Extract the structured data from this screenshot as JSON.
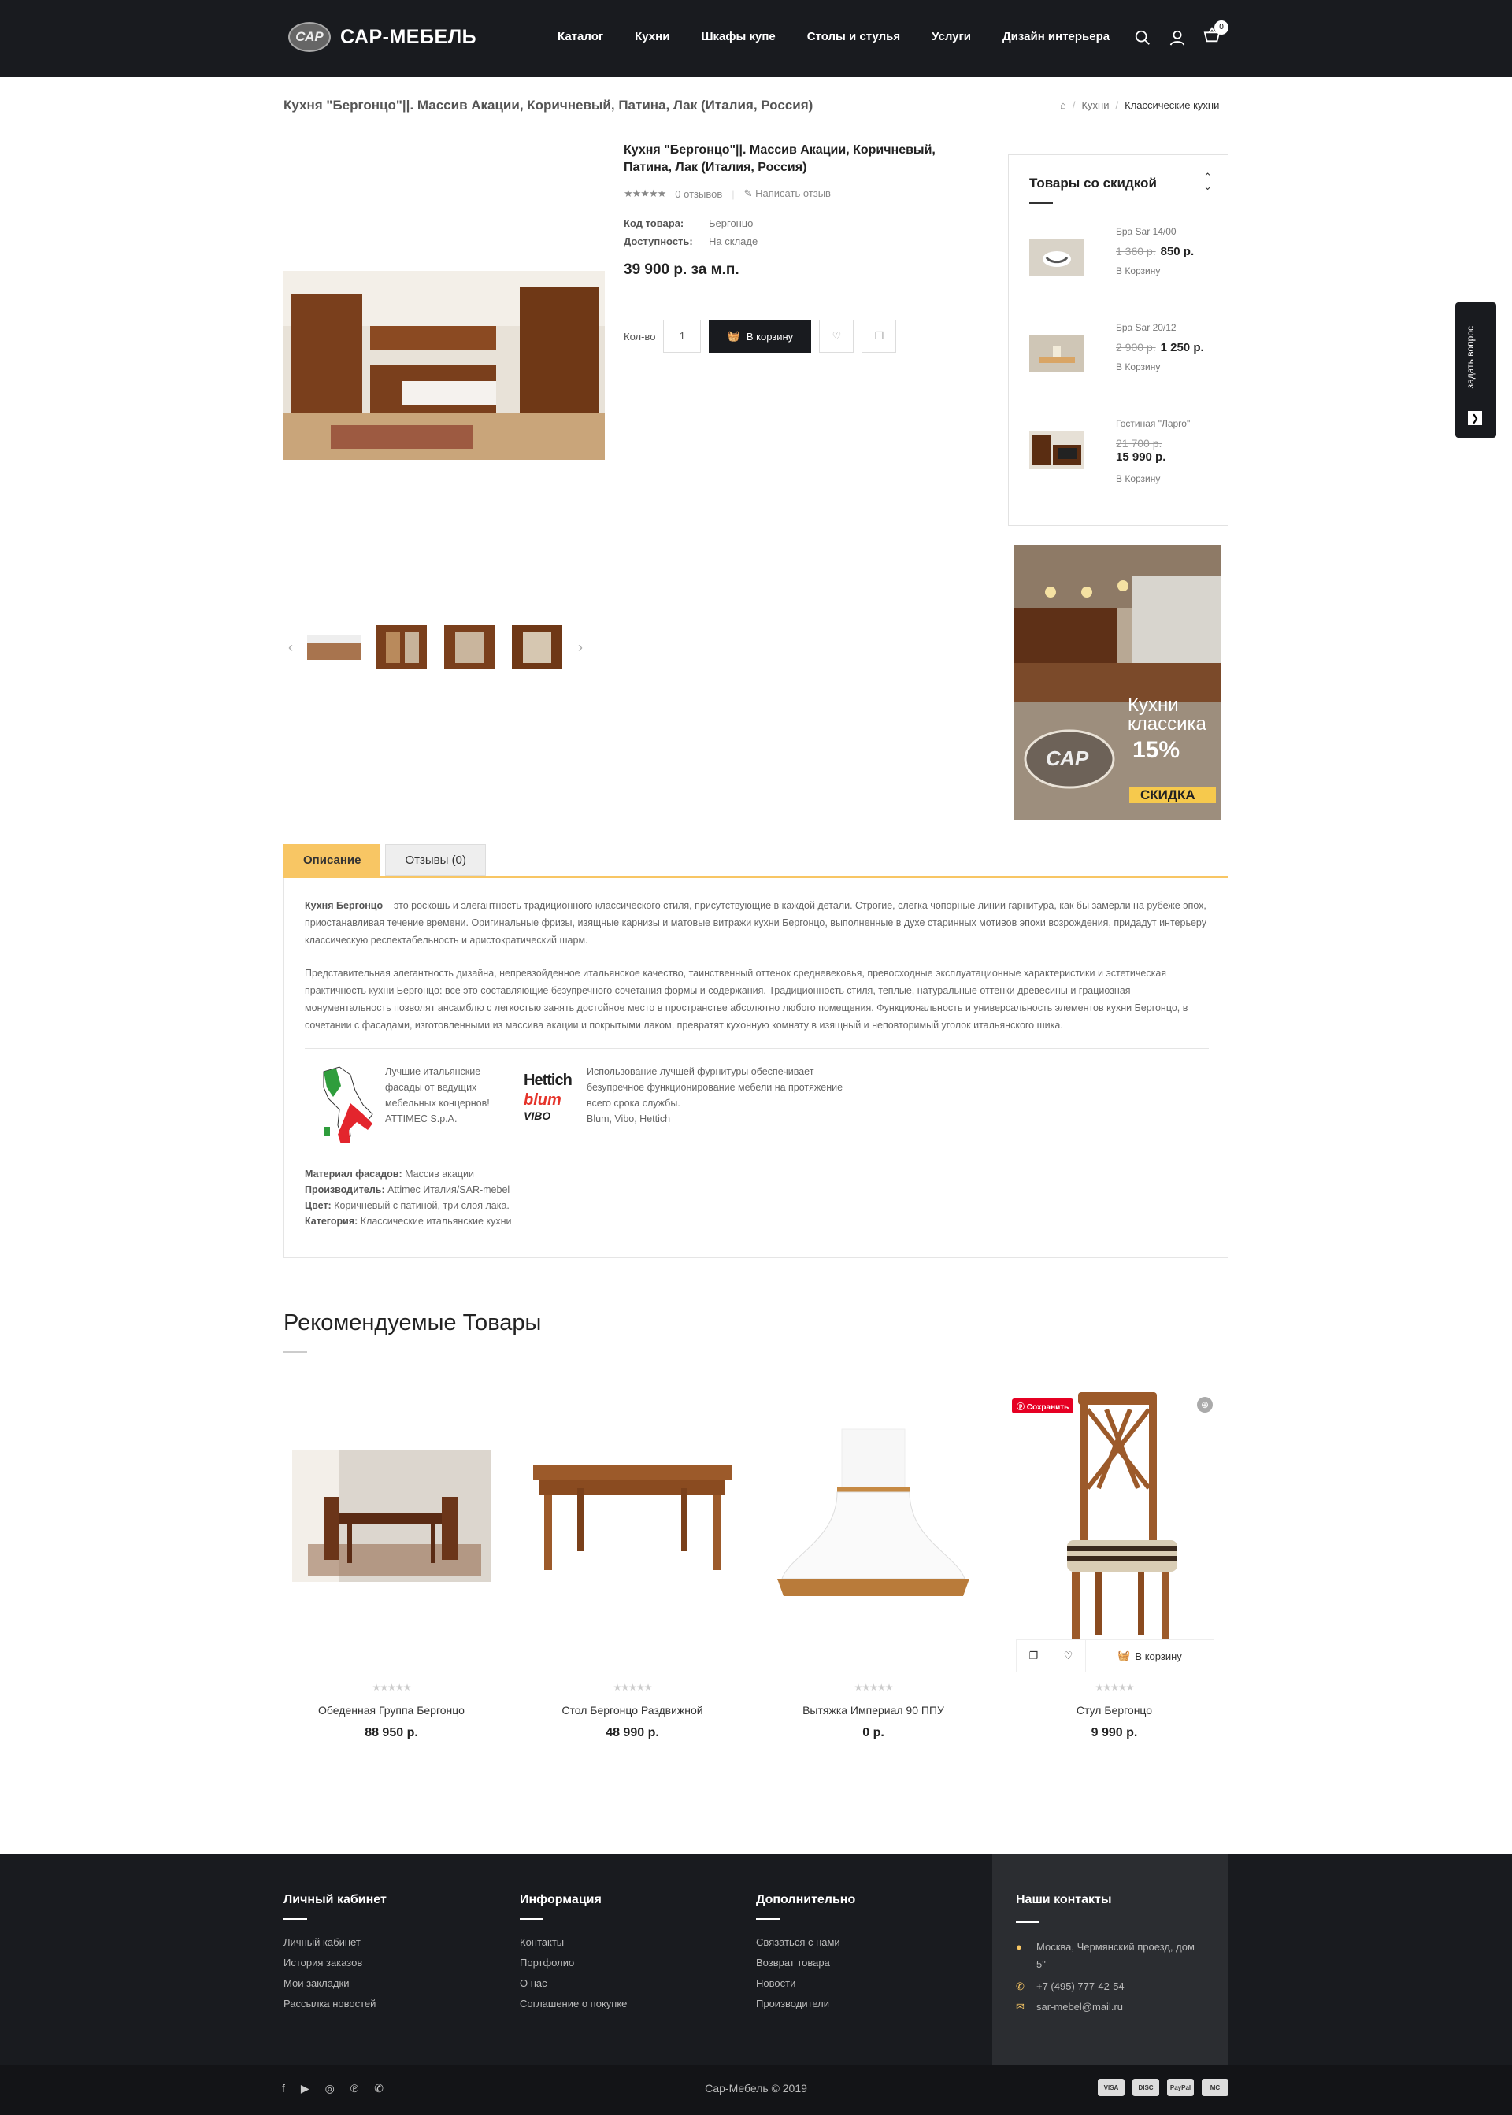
{
  "header": {
    "logo_badge": "САР",
    "logo_text": "САР-МЕБЕЛЬ",
    "nav": [
      "Каталог",
      "Кухни",
      "Шкафы купе",
      "Столы и стулья",
      "Услуги",
      "Дизайн интерьера"
    ],
    "cart_count": "0"
  },
  "page": {
    "title": "Кухня \"Бергонцо\"||. Массив Акации, Коричневый, Патина, Лак (Италия, Россия)",
    "breadcrumb": [
      "Кухни",
      "Классические кухни"
    ]
  },
  "product": {
    "title": "Кухня \"Бергонцо\"||. Массив Акации, Коричневый, Патина, Лак (Италия, Россия)",
    "reviews": "0 отзывов",
    "write_review": "Написать отзыв",
    "code_label": "Код товара:",
    "code_value": "Бергонцо",
    "avail_label": "Доступность:",
    "avail_value": "На складе",
    "price": "39 900 р. за м.п.",
    "qty_label": "Кол-во",
    "qty": "1",
    "cart_btn": "В корзину"
  },
  "sidebar": {
    "title": "Товары со скидкой",
    "items": [
      {
        "name": "Бра Sar 14/00",
        "old": "1 360 р.",
        "price": "850 р.",
        "action": "В Корзину"
      },
      {
        "name": "Бра Sar 20/12",
        "old": "2 900 р.",
        "price": "1 250 р.",
        "action": "В Корзину"
      },
      {
        "name": "Гостиная \"Ларго\"",
        "old": "21 700 р.",
        "price": "15 990 р.",
        "action": "В Корзину"
      }
    ]
  },
  "banner": {
    "l1": "Кухни",
    "l2": "классика",
    "l3": "15%",
    "l4": "СКИДКА",
    "badge": "САР"
  },
  "ask": "задать вопрос",
  "tabs": {
    "desc": "Описание",
    "reviews": "Отзывы (0)"
  },
  "description": {
    "p1_bold": "Кухня Бергонцо",
    "p1": " – это роскошь и элегантность традиционного классического стиля, присутствующие в каждой детали. Строгие, слегка чопорные линии гарнитура, как бы замерли на рубеже эпох, приостанавливая течение времени. Оригинальные фризы, изящные карнизы и матовые витражи кухни Бергонцо, выполненные в духе старинных мотивов эпохи возрождения, придадут интерьеру классическую респектабельность и аристократический шарм.",
    "p2": "Представительная элегантность дизайна, непревзойденное итальянское качество, таинственный оттенок средневековья, превосходные эксплуатационные характеристики и эстетическая практичность кухни Бергонцо: все это составляющие безупречного сочетания формы и содержания. Традиционность стиля, теплые, натуральные оттенки древесины и грациозная монументальность позволят ансамблю с легкостью занять достойное место в пространстве абсолютно любого помещения. Функциональность и универсальность элементов кухни Бергонцо, в сочетании с фасадами, изготовленными из массива акации и покрытыми лаком, превратят кухонную комнату в изящный и неповторимый уголок итальянского шика.",
    "italy_text": [
      "Лучшие итальянские",
      "фасады от ведущих",
      "мебельных концернов!",
      "ATTIMEC S.p.A."
    ],
    "hw_text": [
      "Использование лучшей фурнитуры обеспечивает",
      "безупречное функционирование мебели на протяжение",
      "всего срока службы.",
      "Blum, Vibo, Hettich"
    ],
    "hw_logos": [
      "Hettich",
      "blum",
      "VIBO"
    ],
    "specs": [
      {
        "label": "Материал фасадов:",
        "value": " Массив акации"
      },
      {
        "label": "Производитель:",
        "value": " Attimec Италия/SAR-mebel"
      },
      {
        "label": "Цвет:",
        "value": " Коричневый с патиной, три слоя лака."
      },
      {
        "label": "Категория:",
        "value": " Классические итальянские кухни"
      }
    ]
  },
  "recommended": {
    "title": "Рекомендуемые Товары",
    "pin": "Сохранить",
    "cart_btn": "В корзину",
    "items": [
      {
        "name": "Обеденная Группа Бергонцо",
        "price": "88 950 р."
      },
      {
        "name": "Стол Бергонцо Раздвижной",
        "price": "48 990 р."
      },
      {
        "name": "Вытяжка Империал 90 ППУ",
        "price": "0 р."
      },
      {
        "name": "Стул Бергонцо",
        "price": "9 990 р."
      }
    ]
  },
  "footer": {
    "col1": {
      "title": "Личный кабинет",
      "links": [
        "Личный кабинет",
        "История заказов",
        "Мои закладки",
        "Рассылка новостей"
      ]
    },
    "col2": {
      "title": "Информация",
      "links": [
        "Контакты",
        "Портфолио",
        "О нас",
        "Соглашение о покупке"
      ]
    },
    "col3": {
      "title": "Дополнительно",
      "links": [
        "Связаться с нами",
        "Возврат товара",
        "Новости",
        "Производители"
      ]
    },
    "contacts": {
      "title": "Наши контакты",
      "address1": "Москва, Чермянский проезд, дом",
      "address2": "5\"",
      "phone": "+7 (495) 777-42-54",
      "email": "sar-mebel@mail.ru"
    },
    "copyright": "Сар-Мебель © 2019",
    "payments": [
      "VISA",
      "DISC",
      "PayPal",
      "MC"
    ]
  }
}
